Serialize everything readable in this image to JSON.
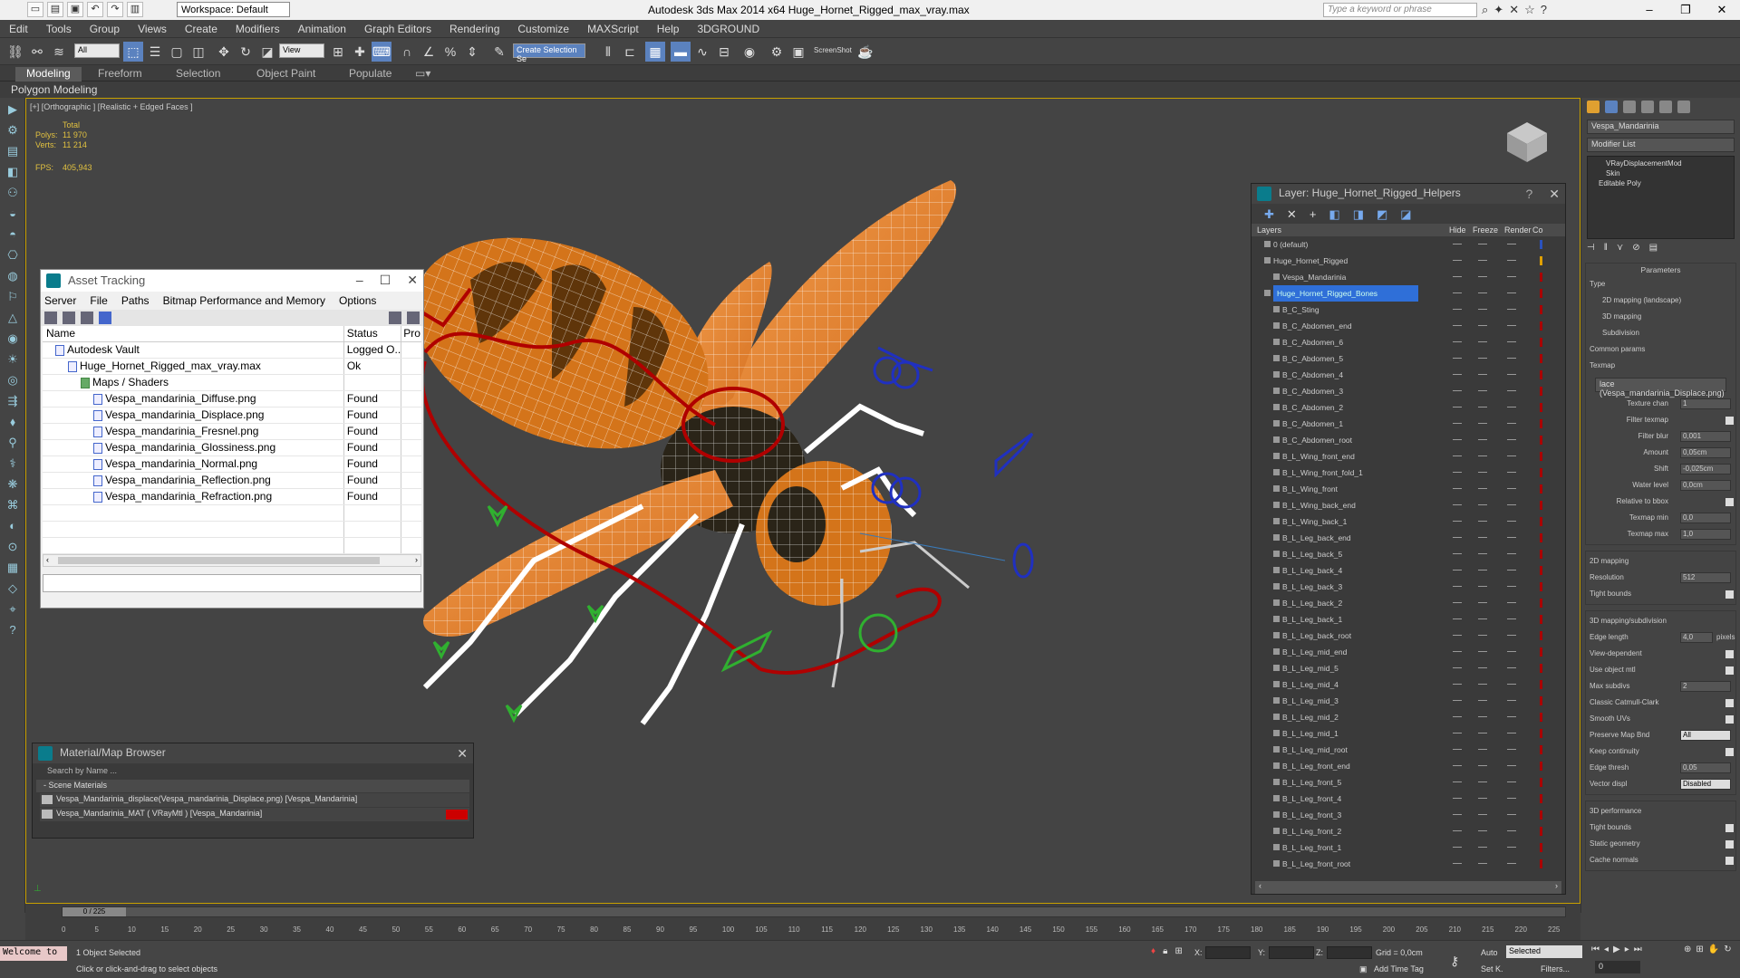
{
  "title_bar": {
    "app_title": "Autodesk 3ds Max  2014 x64      Huge_Hornet_Rigged_max_vray.max",
    "workspace": "Workspace: Default",
    "search_placeholder": "Type a keyword or phrase"
  },
  "menu": [
    "Edit",
    "Tools",
    "Group",
    "Views",
    "Create",
    "Modifiers",
    "Animation",
    "Graph Editors",
    "Rendering",
    "Customize",
    "MAXScript",
    "Help",
    "3DGROUND"
  ],
  "toolbar": {
    "filter": "All",
    "view": "View",
    "selection_set": "Create Selection Se",
    "screenshot": "ScreenShot"
  },
  "ribbon": {
    "tabs": [
      "Modeling",
      "Freeform",
      "Selection",
      "Object Paint",
      "Populate"
    ],
    "sub": "Polygon Modeling"
  },
  "viewport": {
    "label": "[+] [Orthographic ] [Realistic + Edged Faces ]",
    "stats": {
      "total": "Total",
      "polys_label": "Polys:",
      "polys": "11 970",
      "verts_label": "Verts:",
      "verts": "11 214",
      "fps_label": "FPS:",
      "fps": "405,943"
    }
  },
  "asset_tracking": {
    "title": "Asset Tracking",
    "menu": [
      "Server",
      "File",
      "Paths",
      "Bitmap Performance and Memory",
      "Options"
    ],
    "columns": [
      "Name",
      "Status",
      "Pro"
    ],
    "rows": [
      {
        "name": "Autodesk Vault",
        "status": "Logged O..."
      },
      {
        "name": "Huge_Hornet_Rigged_max_vray.max",
        "status": "Ok"
      },
      {
        "name": "Maps / Shaders",
        "status": ""
      },
      {
        "name": "Vespa_mandarinia_Diffuse.png",
        "status": "Found"
      },
      {
        "name": "Vespa_mandarinia_Displace.png",
        "status": "Found"
      },
      {
        "name": "Vespa_mandarinia_Fresnel.png",
        "status": "Found"
      },
      {
        "name": "Vespa_mandarinia_Glossiness.png",
        "status": "Found"
      },
      {
        "name": "Vespa_mandarinia_Normal.png",
        "status": "Found"
      },
      {
        "name": "Vespa_mandarinia_Reflection.png",
        "status": "Found"
      },
      {
        "name": "Vespa_mandarinia_Refraction.png",
        "status": "Found"
      }
    ]
  },
  "material_browser": {
    "title": "Material/Map Browser",
    "search": "Search by Name ...",
    "section": "- Scene Materials",
    "items": [
      "Vespa_Mandarinia_displace(Vespa_mandarinia_Displace.png) [Vespa_Mandarinia]",
      "Vespa_Mandarinia_MAT ( VRayMtl ) [Vespa_Mandarinia]"
    ]
  },
  "layer_window": {
    "title": "Layer: Huge_Hornet_Rigged_Helpers",
    "columns": [
      "Layers",
      "Hide",
      "Freeze",
      "Render",
      "Co"
    ],
    "rows": [
      {
        "name": "0 (default)",
        "indent": 1,
        "selected": false
      },
      {
        "name": "Huge_Hornet_Rigged",
        "indent": 1,
        "selected": false
      },
      {
        "name": "Vespa_Mandarinia",
        "indent": 2,
        "selected": false
      },
      {
        "name": "Huge_Hornet_Rigged_Bones",
        "indent": 1,
        "selected": true
      },
      {
        "name": "B_C_Sting",
        "indent": 2,
        "selected": false
      },
      {
        "name": "B_C_Abdomen_end",
        "indent": 2,
        "selected": false
      },
      {
        "name": "B_C_Abdomen_6",
        "indent": 2,
        "selected": false
      },
      {
        "name": "B_C_Abdomen_5",
        "indent": 2,
        "selected": false
      },
      {
        "name": "B_C_Abdomen_4",
        "indent": 2,
        "selected": false
      },
      {
        "name": "B_C_Abdomen_3",
        "indent": 2,
        "selected": false
      },
      {
        "name": "B_C_Abdomen_2",
        "indent": 2,
        "selected": false
      },
      {
        "name": "B_C_Abdomen_1",
        "indent": 2,
        "selected": false
      },
      {
        "name": "B_C_Abdomen_root",
        "indent": 2,
        "selected": false
      },
      {
        "name": "B_L_Wing_front_end",
        "indent": 2,
        "selected": false
      },
      {
        "name": "B_L_Wing_front_fold_1",
        "indent": 2,
        "selected": false
      },
      {
        "name": "B_L_Wing_front",
        "indent": 2,
        "selected": false
      },
      {
        "name": "B_L_Wing_back_end",
        "indent": 2,
        "selected": false
      },
      {
        "name": "B_L_Wing_back_1",
        "indent": 2,
        "selected": false
      },
      {
        "name": "B_L_Leg_back_end",
        "indent": 2,
        "selected": false
      },
      {
        "name": "B_L_Leg_back_5",
        "indent": 2,
        "selected": false
      },
      {
        "name": "B_L_Leg_back_4",
        "indent": 2,
        "selected": false
      },
      {
        "name": "B_L_Leg_back_3",
        "indent": 2,
        "selected": false
      },
      {
        "name": "B_L_Leg_back_2",
        "indent": 2,
        "selected": false
      },
      {
        "name": "B_L_Leg_back_1",
        "indent": 2,
        "selected": false
      },
      {
        "name": "B_L_Leg_back_root",
        "indent": 2,
        "selected": false
      },
      {
        "name": "B_L_Leg_mid_end",
        "indent": 2,
        "selected": false
      },
      {
        "name": "B_L_Leg_mid_5",
        "indent": 2,
        "selected": false
      },
      {
        "name": "B_L_Leg_mid_4",
        "indent": 2,
        "selected": false
      },
      {
        "name": "B_L_Leg_mid_3",
        "indent": 2,
        "selected": false
      },
      {
        "name": "B_L_Leg_mid_2",
        "indent": 2,
        "selected": false
      },
      {
        "name": "B_L_Leg_mid_1",
        "indent": 2,
        "selected": false
      },
      {
        "name": "B_L_Leg_mid_root",
        "indent": 2,
        "selected": false
      },
      {
        "name": "B_L_Leg_front_end",
        "indent": 2,
        "selected": false
      },
      {
        "name": "B_L_Leg_front_5",
        "indent": 2,
        "selected": false
      },
      {
        "name": "B_L_Leg_front_4",
        "indent": 2,
        "selected": false
      },
      {
        "name": "B_L_Leg_front_3",
        "indent": 2,
        "selected": false
      },
      {
        "name": "B_L_Leg_front_2",
        "indent": 2,
        "selected": false
      },
      {
        "name": "B_L_Leg_front_1",
        "indent": 2,
        "selected": false
      },
      {
        "name": "B_L_Leg_front_root",
        "indent": 2,
        "selected": false
      }
    ]
  },
  "command_panel": {
    "object_name": "Vespa_Mandarinia",
    "modifier_list": "Modifier List",
    "stack": [
      "VRayDisplacementMod",
      "Skin",
      "Editable Poly"
    ],
    "parameters": "Parameters",
    "type_label": "Type",
    "type_options": [
      "2D mapping (landscape)",
      "3D mapping",
      "Subdivision"
    ],
    "common_params": "Common params",
    "texmap_label": "Texmap",
    "texmap_value": "lace (Vespa_mandarinia_Displace.png)",
    "params": [
      {
        "label": "Texture chan",
        "value": "1"
      },
      {
        "label": "Filter texmap",
        "value": ""
      },
      {
        "label": "Filter blur",
        "value": "0,001"
      },
      {
        "label": "Amount",
        "value": "0,05cm"
      },
      {
        "label": "Shift",
        "value": "-0,025cm"
      },
      {
        "label": "Water level",
        "value": "0,0cm"
      },
      {
        "label": "Relative to bbox",
        "value": ""
      },
      {
        "label": "Texmap min",
        "value": "0,0"
      },
      {
        "label": "Texmap max",
        "value": "1,0"
      }
    ],
    "mapping2d": "2D mapping",
    "resolution_label": "Resolution",
    "resolution": "512",
    "tight_bounds": "Tight bounds",
    "subdiv_header": "3D mapping/subdivision",
    "edge_length_label": "Edge length",
    "edge_length": "4,0",
    "pixels": "pixels",
    "subdiv_opts": [
      "View-dependent",
      "Use object mtl"
    ],
    "max_subdivs_label": "Max subdivs",
    "max_subdivs": "2",
    "subdiv_opts2": [
      "Classic Catmull-Clark",
      "Smooth UVs"
    ],
    "preserve_label": "Preserve Map Bnd",
    "preserve_value": "All",
    "keep_continuity": "Keep continuity",
    "edge_thresh_label": "Edge thresh",
    "edge_thresh": "0,05",
    "vector_label": "Vector displ",
    "vector_value": "Disabled",
    "perf_header": "3D performance",
    "perf_opts": [
      "Tight bounds",
      "Static geometry",
      "Cache normals"
    ]
  },
  "timeline": {
    "frame": "0 / 225",
    "ticks": [
      "0",
      "5",
      "10",
      "15",
      "20",
      "25",
      "30",
      "35",
      "40",
      "45",
      "50",
      "55",
      "60",
      "65",
      "70",
      "75",
      "80",
      "85",
      "90",
      "95",
      "100",
      "105",
      "110",
      "115",
      "120",
      "125",
      "130",
      "135",
      "140",
      "145",
      "150",
      "155",
      "160",
      "165",
      "170",
      "175",
      "180",
      "185",
      "190",
      "195",
      "200",
      "205",
      "210",
      "215",
      "220",
      "225"
    ]
  },
  "status": {
    "maxscript": "Welcome to",
    "selected": "1 Object Selected",
    "prompt": "Click or click-and-drag to select objects",
    "x": "X:",
    "y": "Y:",
    "z": "Z:",
    "grid": "Grid = 0,0cm",
    "add_time_tag": "Add Time Tag",
    "auto": "Auto",
    "setk": "Set K.",
    "selected_dd": "Selected",
    "filters": "Filters...",
    "frame_field": "0"
  },
  "colors": {
    "accent": "#5b82bf",
    "viewport_border": "#c8a000",
    "wing": "#e8913a",
    "bone_red": "#b00000",
    "helper_blue": "#2030c0",
    "helper_green": "#30b030"
  }
}
